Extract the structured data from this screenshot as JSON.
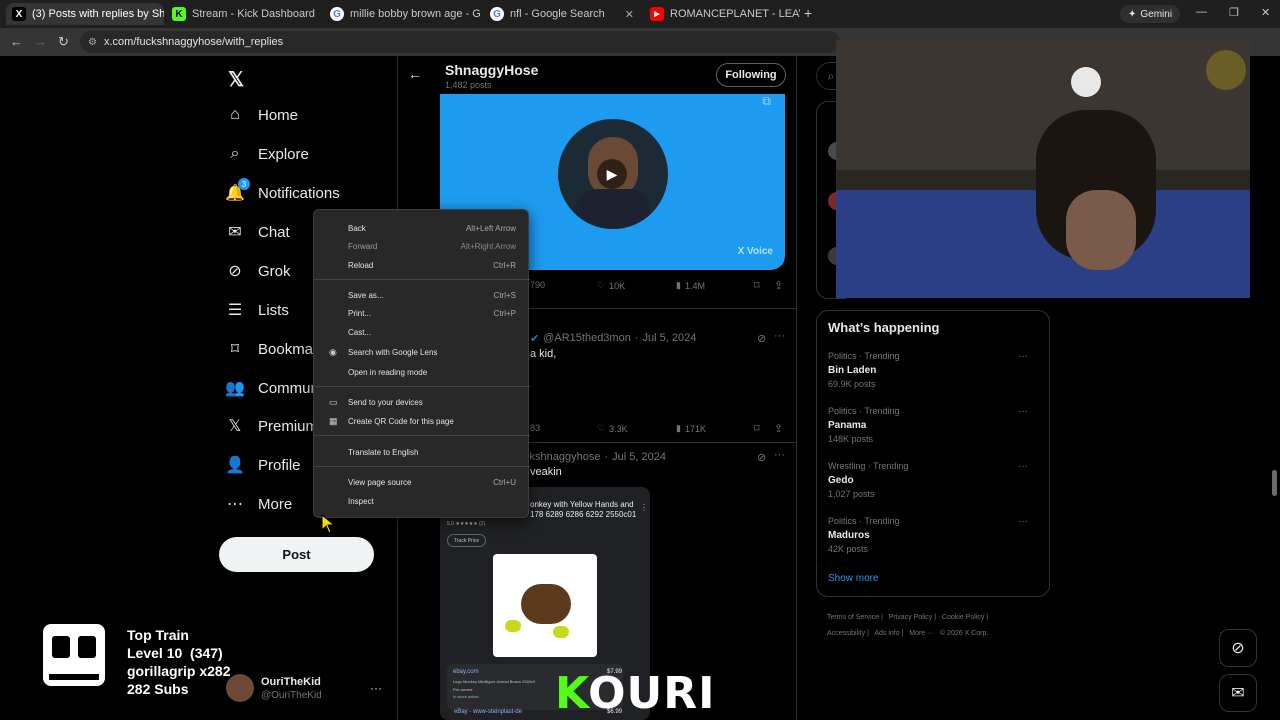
{
  "browser": {
    "tabs": [
      {
        "title": "(3) Posts with replies by Shnagg",
        "favicon": "X",
        "active": true
      },
      {
        "title": "Stream - Kick Dashboard",
        "favicon": "K"
      },
      {
        "title": "millie bobby brown age - Goog",
        "favicon": "G"
      },
      {
        "title": "nfl - Google Search",
        "favicon": "G"
      },
      {
        "title": "ROMANCEPLANET - LEAVE TO",
        "favicon": "YT"
      }
    ],
    "gemini_label": "Gemini",
    "url": "x.com/fuckshnaggyhose/with_replies"
  },
  "sidebar": {
    "items": [
      {
        "label": "Home",
        "icon": "home-icon"
      },
      {
        "label": "Explore",
        "icon": "search-icon"
      },
      {
        "label": "Notifications",
        "icon": "bell-icon",
        "badge": "3"
      },
      {
        "label": "Chat",
        "icon": "mail-icon"
      },
      {
        "label": "Grok",
        "icon": "grok-icon"
      },
      {
        "label": "Lists",
        "icon": "list-icon"
      },
      {
        "label": "Bookmar",
        "icon": "bookmark-icon"
      },
      {
        "label": "Commun",
        "icon": "people-icon"
      },
      {
        "label": "Premium",
        "icon": "x-logo-icon"
      },
      {
        "label": "Profile",
        "icon": "person-icon"
      },
      {
        "label": "More",
        "icon": "more-circle-icon"
      }
    ],
    "post_label": "Post",
    "account": {
      "name": "OuriTheKid",
      "handle": "@OuriTheKid"
    }
  },
  "profile_header": {
    "name": "ShnaggyHose",
    "posts": "1,482 posts",
    "follow_label": "Following"
  },
  "video_card": {
    "brand": "X Voice"
  },
  "tweet1_stats": {
    "replies": "790",
    "likes": "10K",
    "views": "1.4M"
  },
  "tweet2": {
    "handle": "@AR15thed3mon",
    "date": "Jul 5, 2024",
    "text": "a kid,",
    "replies": "83",
    "likes": "3.3K",
    "views": "171K"
  },
  "tweet3": {
    "handle": "ckshnaggyhose",
    "date": "Jul 5, 2024",
    "text": "veakin",
    "shopping": {
      "title": "onkey with Yellow Hands and",
      "code": "178 6289 6286 6292 2550c01",
      "rating": "5.0 ★★★★★ (2)",
      "track": "Track Price",
      "seller1": "ebay.com",
      "desc1": "Lego Monkey Minifigure Animal Brown 2550c0",
      "cond1": "Pre-owned",
      "stock1": "In stock online",
      "price1": "$7.99",
      "seller2": "eBay - www-steinplast-de",
      "price2": "$6.99"
    }
  },
  "context_menu": {
    "items": [
      {
        "label": "Back",
        "shortcut": "Alt+Left Arrow"
      },
      {
        "label": "Forward",
        "shortcut": "Alt+Right Arrow",
        "disabled": true
      },
      {
        "label": "Reload",
        "shortcut": "Ctrl+R"
      },
      {
        "label": "Save as...",
        "shortcut": "Ctrl+S"
      },
      {
        "label": "Print...",
        "shortcut": "Ctrl+P"
      },
      {
        "label": "Cast..."
      },
      {
        "label": "Search with Google Lens",
        "icon": "lens-icon"
      },
      {
        "label": "Open in reading mode"
      },
      {
        "label": "Send to your devices",
        "icon": "devices-icon"
      },
      {
        "label": "Create QR Code for this page",
        "icon": "qr-code-icon"
      },
      {
        "label": "Translate to English"
      },
      {
        "label": "View page source",
        "shortcut": "Ctrl+U"
      },
      {
        "label": "Inspect"
      }
    ]
  },
  "whats_happening": {
    "title": "What’s happening",
    "trends": [
      {
        "category": "Politics · Trending",
        "name": "Bin Laden",
        "count": "69.9K posts"
      },
      {
        "category": "Politics · Trending",
        "name": "Panama",
        "count": "148K posts"
      },
      {
        "category": "Wrestling · Trending",
        "name": "Gedo",
        "count": "1,027 posts"
      },
      {
        "category": "Politics · Trending",
        "name": "Maduros",
        "count": "42K posts"
      }
    ],
    "show_more": "Show more"
  },
  "footer": {
    "links": [
      "Terms of Service",
      "Privacy Policy",
      "Cookie Policy",
      "Accessibility",
      "Ads info",
      "More ···",
      "© 2026 X Corp."
    ]
  },
  "stream_overlay": {
    "title": "Top Train",
    "level": "Level 10  (347)",
    "gifter": "gorillagrip x282",
    "subs": "282 Subs",
    "logo_text_accent": "K",
    "logo_text": "OURI"
  },
  "colors": {
    "accent": "#1d9bf0",
    "kick_green": "#53fc18",
    "bg": "#000000"
  }
}
